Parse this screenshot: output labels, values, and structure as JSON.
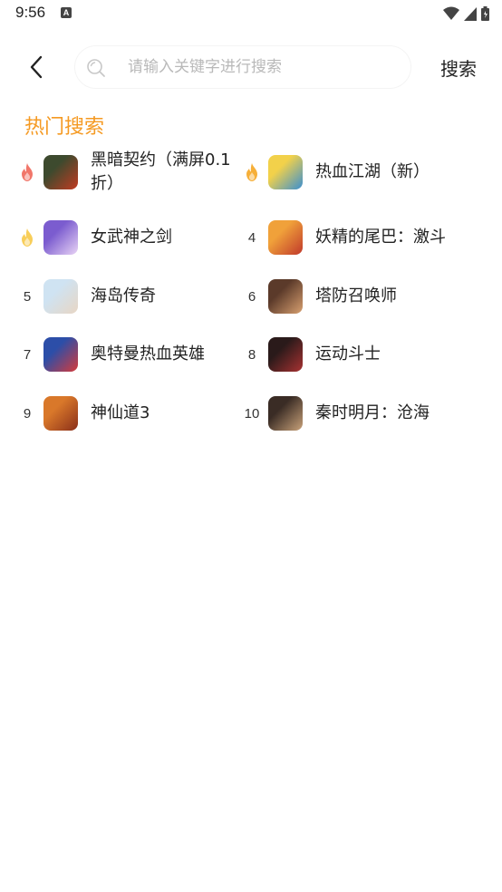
{
  "status_bar": {
    "time": "9:56",
    "notification_badge": "A"
  },
  "header": {
    "search_placeholder": "请输入关键字进行搜索",
    "search_button_label": "搜索"
  },
  "section": {
    "title": "热门搜索"
  },
  "hot_items": [
    {
      "rank": "",
      "rank_icon": "flame-red-icon",
      "name": "黑暗契约（满屏0.1折）",
      "thumb_colors": [
        "#3d4a2e",
        "#c23b22"
      ]
    },
    {
      "rank": "",
      "rank_icon": "flame-orange-icon",
      "name": "热血江湖（新）",
      "thumb_colors": [
        "#f2d14a",
        "#3a8fd1"
      ]
    },
    {
      "rank": "",
      "rank_icon": "flame-yellow-icon",
      "name": "女武神之剑",
      "thumb_colors": [
        "#7b5ccf",
        "#e9d4f5"
      ]
    },
    {
      "rank": "4",
      "rank_icon": "",
      "name": "妖精的尾巴：激斗",
      "thumb_colors": [
        "#f0a13a",
        "#c0392b"
      ]
    },
    {
      "rank": "5",
      "rank_icon": "",
      "name": "海岛传奇",
      "thumb_colors": [
        "#cfe3f2",
        "#e8d6c4"
      ]
    },
    {
      "rank": "6",
      "rank_icon": "",
      "name": "塔防召唤师",
      "thumb_colors": [
        "#5b3a2a",
        "#d8a070"
      ]
    },
    {
      "rank": "7",
      "rank_icon": "",
      "name": "奥特曼热血英雄",
      "thumb_colors": [
        "#2c4ea8",
        "#d63b3b"
      ]
    },
    {
      "rank": "8",
      "rank_icon": "",
      "name": "运动斗士",
      "thumb_colors": [
        "#2a1a1a",
        "#a83232"
      ]
    },
    {
      "rank": "9",
      "rank_icon": "",
      "name": "神仙道3",
      "thumb_colors": [
        "#d9782a",
        "#8a2f1a"
      ]
    },
    {
      "rank": "10",
      "rank_icon": "",
      "name": "秦时明月：沧海",
      "thumb_colors": [
        "#3a2c25",
        "#c9a27a"
      ]
    }
  ],
  "colors": {
    "accent": "#f59a23",
    "flame_red": "#f0675a",
    "flame_orange": "#f5a623",
    "flame_yellow": "#f7c948"
  }
}
